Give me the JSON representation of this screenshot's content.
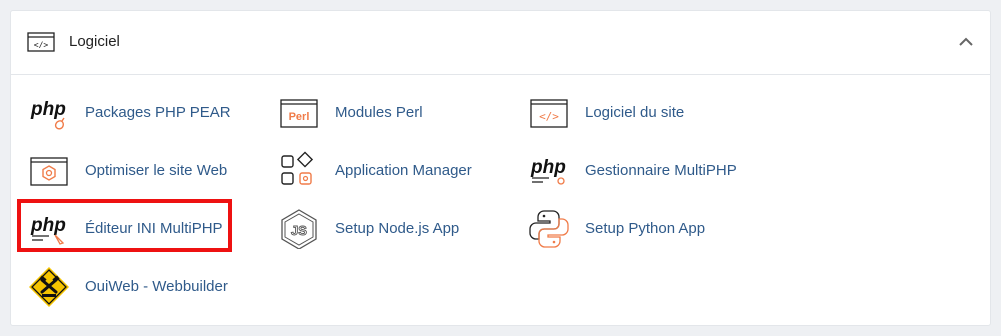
{
  "section": {
    "title": "Logiciel"
  },
  "items": [
    {
      "label": "Packages PHP PEAR",
      "icon": "php-pear-icon"
    },
    {
      "label": "Modules Perl",
      "icon": "perl-icon"
    },
    {
      "label": "Logiciel du site",
      "icon": "code-window-icon"
    },
    {
      "label": "Optimiser le site Web",
      "icon": "optimize-gear-icon"
    },
    {
      "label": "Application Manager",
      "icon": "app-manager-icon"
    },
    {
      "label": "Gestionnaire MultiPHP",
      "icon": "php-icon"
    },
    {
      "label": "Éditeur INI MultiPHP",
      "icon": "php-ini-icon"
    },
    {
      "label": "Setup Node.js App",
      "icon": "nodejs-icon"
    },
    {
      "label": "Setup Python App",
      "icon": "python-icon"
    },
    {
      "label": "OuiWeb - Webbuilder",
      "icon": "webbuilder-icon"
    }
  ],
  "icon_text": {
    "php": "php",
    "perl": "Perl"
  },
  "colors": {
    "link": "#2f5a8a",
    "accent": "#f07b48",
    "highlight": "#ee1111"
  }
}
